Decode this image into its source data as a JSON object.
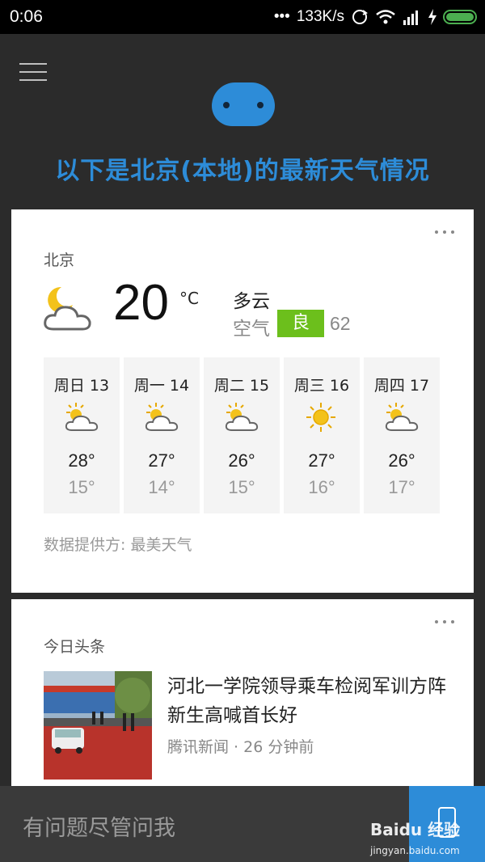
{
  "status_bar": {
    "time": "0:06",
    "dots": "•••",
    "net_speed": "133K/s"
  },
  "header": {
    "headline": "以下是北京(本地)的最新天气情况"
  },
  "weather": {
    "city": "北京",
    "current_icon": "moon-cloud-icon",
    "temperature": "20",
    "unit": "°C",
    "condition": "多云",
    "aqi_label": "空气",
    "aqi_level": "良",
    "aqi_value": "62",
    "forecast": [
      {
        "day": "周日 13",
        "icon": "sun-cloud-icon",
        "high": "28°",
        "low": "15°"
      },
      {
        "day": "周一 14",
        "icon": "sun-cloud-icon",
        "high": "27°",
        "low": "14°"
      },
      {
        "day": "周二 15",
        "icon": "sun-cloud-icon",
        "high": "26°",
        "low": "15°"
      },
      {
        "day": "周三 16",
        "icon": "sun-icon",
        "high": "27°",
        "low": "16°"
      },
      {
        "day": "周四 17",
        "icon": "sun-cloud-icon",
        "high": "26°",
        "low": "17°"
      }
    ],
    "source": "数据提供方: 最美天气"
  },
  "news": {
    "source_label": "今日头条",
    "title": "河北一学院领导乘车检阅军训方阵 新生高喊首长好",
    "meta": "腾讯新闻 · 26 分钟前"
  },
  "bottom": {
    "ask_placeholder": "有问题尽管问我"
  },
  "watermark": {
    "brand": "Baidu 经验",
    "url": "jingyan.baidu.com"
  },
  "colors": {
    "accent": "#2d8cd8",
    "aqi_good": "#6cbf1c",
    "background": "#2b2b2b",
    "battery": "#4caf50"
  }
}
